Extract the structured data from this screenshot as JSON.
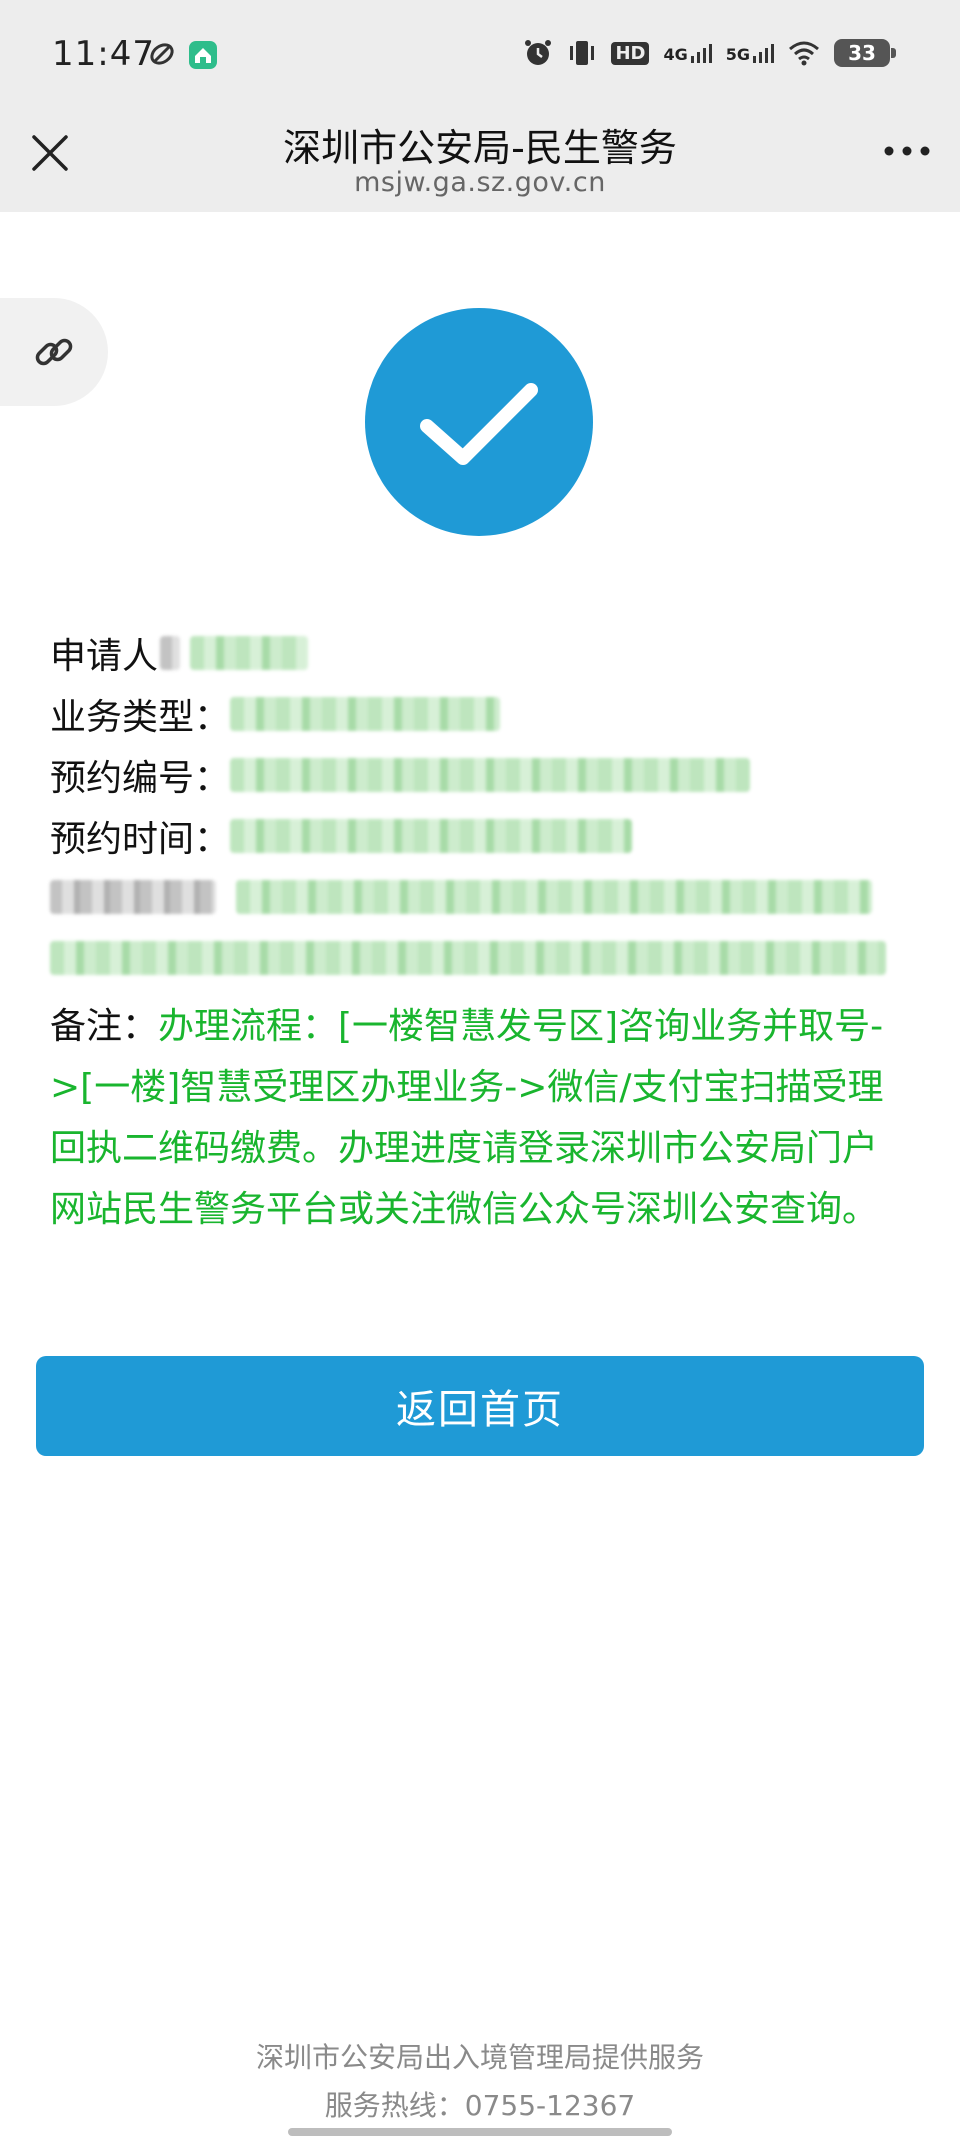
{
  "status_bar": {
    "time": "11:47",
    "left_icons": [
      "sync-icon",
      "home-app-icon"
    ],
    "right_icons": [
      "alarm-icon",
      "vibrate-icon",
      "hd-icon",
      "signal-4g-icon",
      "signal-5g-icon",
      "wifi-icon"
    ],
    "hd_label": "HD",
    "net1_label": "4G",
    "net2_label": "5G",
    "battery": "33"
  },
  "title_bar": {
    "title": "深圳市公安局-民生警务",
    "subtitle": "msjw.ga.sz.gov.cn"
  },
  "success": {
    "icon": "check-circle-icon",
    "color": "#1f9ad6"
  },
  "info": {
    "applicant_label": "申请人",
    "business_type_label": "业务类型：",
    "appointment_no_label": "预约编号：",
    "appointment_time_label": "预约时间：",
    "note_label": "备注：",
    "note_text": "办理流程：[一楼智慧发号区]咨询业务并取号->[一楼]智慧受理区办理业务->微信/支付宝扫描受理回执二维码缴费。办理进度请登录深圳市公安局门户网站民生警务平台或关注微信公众号深圳公安查询。"
  },
  "actions": {
    "home_button": "返回首页"
  },
  "footer": {
    "provider": "深圳市公安局出入境管理局提供服务",
    "hotline": "服务热线：0755-12367"
  },
  "colors": {
    "accent": "#1f9ad6",
    "note_green": "#19b52e",
    "bar_bg": "#ededed"
  }
}
